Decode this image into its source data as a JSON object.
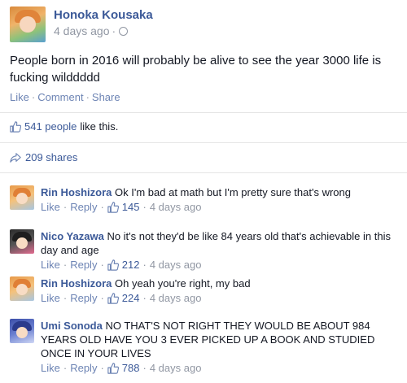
{
  "post": {
    "author": "Honoka Kousaka",
    "time": "4 days ago",
    "text": "People born in 2016 will probably be alive to see the year 3000 life is fucking wilddddd",
    "actions": {
      "like": "Like",
      "comment": "Comment",
      "share": "Share"
    },
    "likes_count": "541 people",
    "likes_suffix": "like this.",
    "shares": "209 shares"
  },
  "comments": [
    {
      "author": "Rin Hoshizora",
      "text": "Ok I'm bad at math but I'm pretty sure that's wrong",
      "like": "Like",
      "reply": "Reply",
      "likes": "145",
      "time": "4 days ago"
    },
    {
      "author": "Nico Yazawa",
      "text": "No it's not they'd be like 84 years old that's achievable in this day and age",
      "like": "Like",
      "reply": "Reply",
      "likes": "212",
      "time": "4 days ago"
    },
    {
      "author": "Rin Hoshizora",
      "text": "Oh yeah you're right, my bad",
      "like": "Like",
      "reply": "Reply",
      "likes": "224",
      "time": "4 days ago"
    },
    {
      "author": "Umi Sonoda",
      "text": "NO THAT'S NOT RIGHT THEY WOULD BE ABOUT 984 YEARS OLD HAVE YOU 3 EVER PICKED UP A BOOK AND STUDIED ONCE IN YOUR LIVES",
      "like": "Like",
      "reply": "Reply",
      "likes": "788",
      "time": "4 days ago"
    }
  ],
  "colors": {
    "link": "#3b5998",
    "muted": "#9197a3",
    "action": "#6d84b4"
  },
  "icons": {
    "like": "thumbs-up-icon",
    "share": "share-arrow-icon",
    "privacy": "globe-icon"
  }
}
